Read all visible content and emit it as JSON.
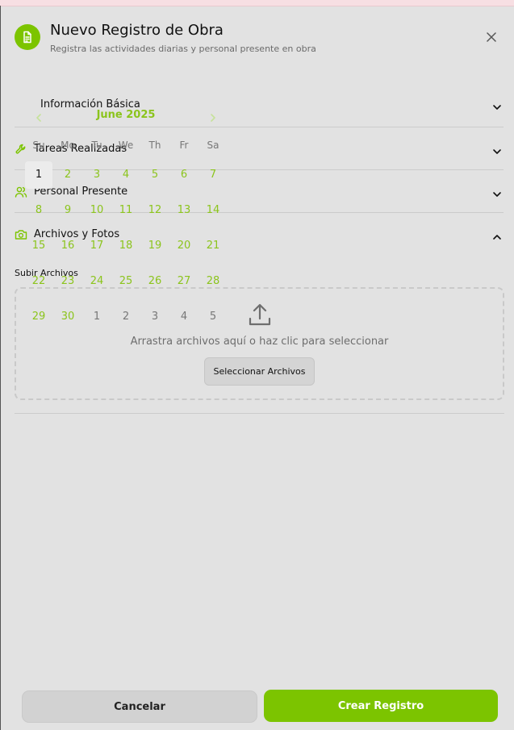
{
  "header": {
    "title": "Nuevo Registro de Obra",
    "subtitle": "Registra las actividades diarias y personal presente en obra",
    "icon": "document-icon"
  },
  "sections": [
    {
      "label": "Información Básica",
      "icon": "",
      "expanded": false
    },
    {
      "label": "Tareas Realizadas",
      "icon": "wrench-icon",
      "expanded": false
    },
    {
      "label": "Personal Presente",
      "icon": "users-icon",
      "expanded": false
    },
    {
      "label": "Archivos y Fotos",
      "icon": "camera-icon",
      "expanded": true
    }
  ],
  "upload": {
    "label": "Subir Archivos",
    "drop_text": "Arrastra archivos aquí o haz clic para seleccionar",
    "button_label": "Seleccionar Archivos"
  },
  "calendar": {
    "month_label": "June 2025",
    "weekdays": [
      "Su",
      "Mo",
      "Tu",
      "We",
      "Th",
      "Fr",
      "Sa"
    ],
    "weeks": [
      [
        "1",
        "2",
        "3",
        "4",
        "5",
        "6",
        "7"
      ],
      [
        "8",
        "9",
        "10",
        "11",
        "12",
        "13",
        "14"
      ],
      [
        "15",
        "16",
        "17",
        "18",
        "19",
        "20",
        "21"
      ],
      [
        "22",
        "23",
        "24",
        "25",
        "26",
        "27",
        "28"
      ],
      [
        "29",
        "30",
        "1",
        "2",
        "3",
        "4",
        "5"
      ]
    ],
    "selected_day": "1"
  },
  "footer": {
    "cancel_label": "Cancelar",
    "create_label": "Crear Registro"
  },
  "colors": {
    "accent": "#7cc400",
    "background": "#e2e2e2"
  }
}
